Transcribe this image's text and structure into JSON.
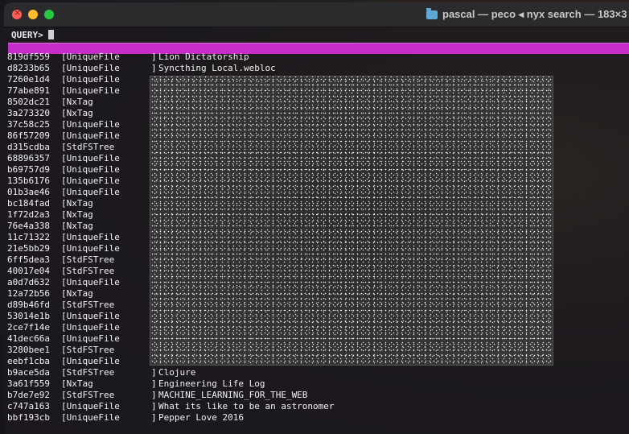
{
  "window": {
    "title": "pascal — peco ◂ nyx search — 183×3"
  },
  "query": {
    "label": "QUERY>",
    "value": ""
  },
  "rows": [
    {
      "id": "819df559",
      "type": "[UniqueFile",
      "name": "Lion Dictatorship"
    },
    {
      "id": "d8233b65",
      "type": "[UniqueFile",
      "name": "Syncthing Local.webloc"
    },
    {
      "id": "7260e1d4",
      "type": "[UniqueFile",
      "name": ""
    },
    {
      "id": "77abe891",
      "type": "[UniqueFile",
      "name": ""
    },
    {
      "id": "8502dc21",
      "type": "[NxTag",
      "name": ""
    },
    {
      "id": "3a273320",
      "type": "[NxTag",
      "name": ""
    },
    {
      "id": "37c58c25",
      "type": "[UniqueFile",
      "name": ""
    },
    {
      "id": "86f57209",
      "type": "[UniqueFile",
      "name": ""
    },
    {
      "id": "d315cdba",
      "type": "[StdFSTree",
      "name": ""
    },
    {
      "id": "68896357",
      "type": "[UniqueFile",
      "name": ""
    },
    {
      "id": "b69757d9",
      "type": "[UniqueFile",
      "name": ""
    },
    {
      "id": "135b6176",
      "type": "[UniqueFile",
      "name": ""
    },
    {
      "id": "01b3ae46",
      "type": "[UniqueFile",
      "name": ""
    },
    {
      "id": "bc184fad",
      "type": "[NxTag",
      "name": ""
    },
    {
      "id": "1f72d2a3",
      "type": "[NxTag",
      "name": ""
    },
    {
      "id": "76e4a338",
      "type": "[NxTag",
      "name": ""
    },
    {
      "id": "11c71322",
      "type": "[UniqueFile",
      "name": ""
    },
    {
      "id": "21e5bb29",
      "type": "[UniqueFile",
      "name": ""
    },
    {
      "id": "6ff5dea3",
      "type": "[StdFSTree",
      "name": ""
    },
    {
      "id": "40017e04",
      "type": "[StdFSTree",
      "name": ""
    },
    {
      "id": "a0d7d632",
      "type": "[UniqueFile",
      "name": ""
    },
    {
      "id": "12a72b56",
      "type": "[NxTag",
      "name": ""
    },
    {
      "id": "d89b46fd",
      "type": "[StdFSTree",
      "name": ""
    },
    {
      "id": "53014e1b",
      "type": "[UniqueFile",
      "name": ""
    },
    {
      "id": "2ce7f14e",
      "type": "[UniqueFile",
      "name": ""
    },
    {
      "id": "41dec66a",
      "type": "[UniqueFile",
      "name": ""
    },
    {
      "id": "3280bee1",
      "type": "[StdFSTree",
      "name": ""
    },
    {
      "id": "eebf1cba",
      "type": "[UniqueFile",
      "name": ""
    },
    {
      "id": "b9ace5da",
      "type": "[StdFSTree",
      "name": "Clojure"
    },
    {
      "id": "3a61f559",
      "type": "[NxTag",
      "name": "Engineering Life Log"
    },
    {
      "id": "b7de7e92",
      "type": "[StdFSTree",
      "name": "MACHINE_LEARNING_FOR_THE_WEB"
    },
    {
      "id": "c747a163",
      "type": "[UniqueFile",
      "name": "What its like to be an astronomer"
    },
    {
      "id": "bbf193cb",
      "type": "[UniqueFile",
      "name": "Pepper Love 2016"
    }
  ]
}
